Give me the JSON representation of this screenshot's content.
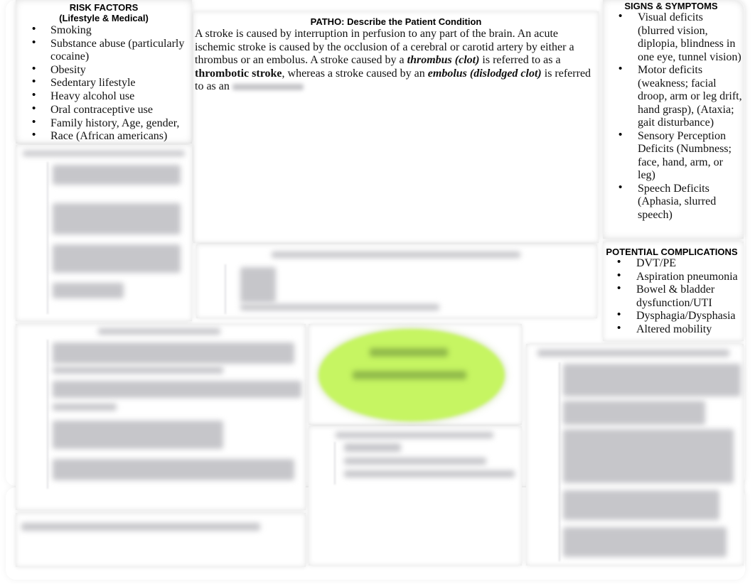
{
  "risk_factors": {
    "title": "RISK FACTORS",
    "subtitle": "(Lifestyle & Medical)",
    "items": [
      "Smoking",
      "Substance abuse (particularly",
      "cocaine)",
      "Obesity",
      "Sedentary lifestyle",
      "Heavy alcohol use",
      "Oral contraceptive use",
      "Family history, Age, gender,",
      "Race (African americans)"
    ]
  },
  "patho": {
    "title": "PATHO:  Describe the Patient Condition",
    "text_1": "A stroke is caused by interruption in perfusion to any part of the brain. An acute ischemic stroke is caused by the occlusion of a cerebral or carotid artery by either a thrombus or an embolus. A stroke caused by a ",
    "bold_italic_1": "thrombus (clot)",
    "text_2": " is referred to as a ",
    "bold_1": "thrombotic stroke",
    "text_3": ", whereas a stroke caused by an ",
    "bold_italic_2": "embolus (dislodged clot)",
    "text_4": " is referred to as an "
  },
  "signs_symptoms": {
    "title": "SIGNS & SYMPTOMS",
    "items": [
      "Visual deficits (blurred vision, diplopia, blindness in one eye, tunnel vision)",
      "Motor deficits (weakness; facial droop, arm or leg drift, hand grasp), (Ataxia; gait disturbance)",
      "Sensory Perception Deficits (Numbness; face, hand, arm, or leg)",
      "Speech Deficits (Aphasia, slurred speech)"
    ]
  },
  "complications": {
    "title": "POTENTIAL COMPLICATIONS",
    "items": [
      "DVT/PE",
      "Aspiration pneumonia",
      "Bowel & bladder dysfunction/UTI",
      "Dysphagia/Dysphasia",
      "Altered mobility"
    ]
  },
  "bullet_glyph": "•",
  "colors": {
    "concept_ellipse": "#c6f562",
    "blurred_text": "#c6c6ca"
  }
}
